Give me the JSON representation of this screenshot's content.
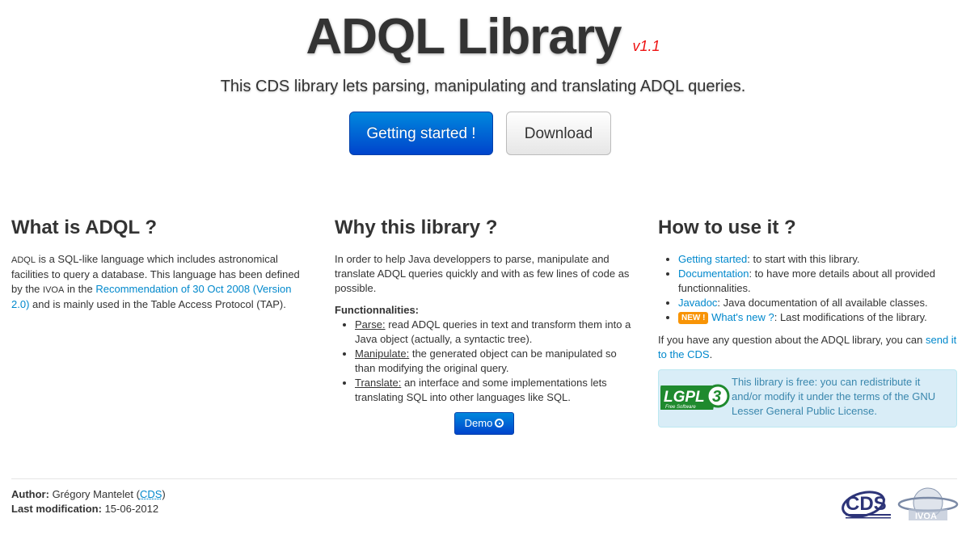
{
  "hero": {
    "title": "ADQL Library",
    "version": "v1.1",
    "subtitle": "This CDS library lets parsing, manipulating and translating ADQL queries.",
    "btn_getting_started": "Getting started !",
    "btn_download": "Download"
  },
  "col1": {
    "heading": "What is ADQL ?",
    "adql": "ADQL",
    "text1": " is a SQL-like language which includes astronomical facilities to query a database. This language has been defined by the ",
    "ivoa": "IVOA",
    "text2": " in the ",
    "rec_link": "Recommendation of 30 Oct 2008 (Version 2.0)",
    "text3": " and is mainly used in the Table Access Protocol (TAP)."
  },
  "col2": {
    "heading": "Why this library ?",
    "intro": "In order to help Java developpers to parse, manipulate and translate ADQL queries quickly and with as few lines of code as possible.",
    "func_title": "Functionnalities:",
    "items": [
      {
        "term": "Parse:",
        "desc": " read ADQL queries in text and transform them into a Java object (actually, a syntactic tree)."
      },
      {
        "term": "Manipulate:",
        "desc": " the generated object can be manipulated so than modifying the original query."
      },
      {
        "term": "Translate:",
        "desc": " an interface and some implementations lets translating SQL into other languages like SQL."
      }
    ],
    "demo_label": "Demo"
  },
  "col3": {
    "heading": "How to use it ?",
    "items": [
      {
        "link": "Getting started",
        "desc": ": to start with this library."
      },
      {
        "link": "Documentation",
        "desc": ": to have more details about all provided functionnalities."
      },
      {
        "link": "Javadoc",
        "desc": ": Java documentation of all available classes."
      },
      {
        "badge": "NEW !",
        "link": "What's new ?",
        "desc": ": Last modifications of the library."
      }
    ],
    "question_text": "If you have any question about the ADQL library, you can ",
    "question_link": "send it to the CDS",
    "question_end": ".",
    "license_text": "This library is free: you can redistribute it and/or modify it under the terms of the GNU Lesser General Public License.",
    "lgpl_logo_text": "LGPL",
    "lgpl_logo_sub": "Free Software",
    "lgpl_logo_num": "3"
  },
  "footer": {
    "author_label": "Author:",
    "author_name": "Grégory Mantelet (",
    "author_org": "CDS",
    "author_end": ")",
    "mod_label": "Last modification:",
    "mod_date": "15-06-2012",
    "cds_logo_text": "CDS",
    "ivoa_logo_text": "IVOA"
  },
  "colors": {
    "primary": "#0055cc",
    "link": "#0088cc",
    "version_red": "#ee1111",
    "badge_orange": "#f89406",
    "info_bg": "#d9edf7",
    "info_text": "#3a87ad"
  }
}
